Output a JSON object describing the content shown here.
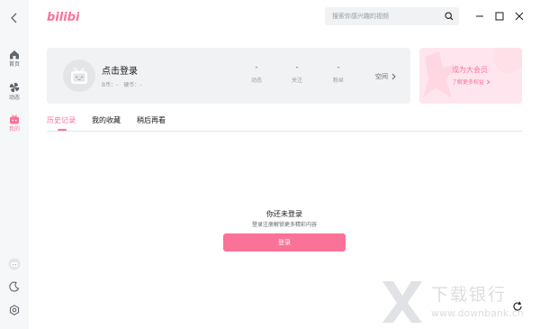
{
  "app": {
    "logo_text": "bilibili",
    "brand_color": "#fb7299"
  },
  "search": {
    "placeholder": "搜索你感兴趣的视频",
    "icon": "search-icon"
  },
  "window_controls": [
    "minimize-icon",
    "maximize-icon",
    "close-icon"
  ],
  "sidebar": {
    "back_icon": "chevron-left-icon",
    "items": [
      {
        "label": "首页",
        "icon": "home-icon",
        "active": false
      },
      {
        "label": "动态",
        "icon": "pinwheel-icon",
        "active": false
      },
      {
        "label": "我的",
        "icon": "tv-icon",
        "active": true
      }
    ],
    "bottom_icons": [
      "user-avatar-icon",
      "moon-icon",
      "settings-icon"
    ]
  },
  "profile": {
    "login_title": "点击登录",
    "b_coin": "B币：-",
    "hard_coin": "硬币：-",
    "stats": [
      {
        "value": "-",
        "label": "动态"
      },
      {
        "value": "-",
        "label": "关注"
      },
      {
        "value": "-",
        "label": "粉丝"
      }
    ],
    "space_label": "空间"
  },
  "vip": {
    "title": "成为大会员",
    "subtitle": "了解更多权益"
  },
  "tabs": [
    {
      "label": "历史记录",
      "active": true
    },
    {
      "label": "我的收藏",
      "active": false
    },
    {
      "label": "稍后再看",
      "active": false
    }
  ],
  "empty_state": {
    "title": "你还未登录",
    "subtitle": "登录注册解锁更多精彩内容",
    "button_label": "登录"
  },
  "watermark": {
    "name": "下载银行",
    "url": "www.downbank.cn"
  }
}
